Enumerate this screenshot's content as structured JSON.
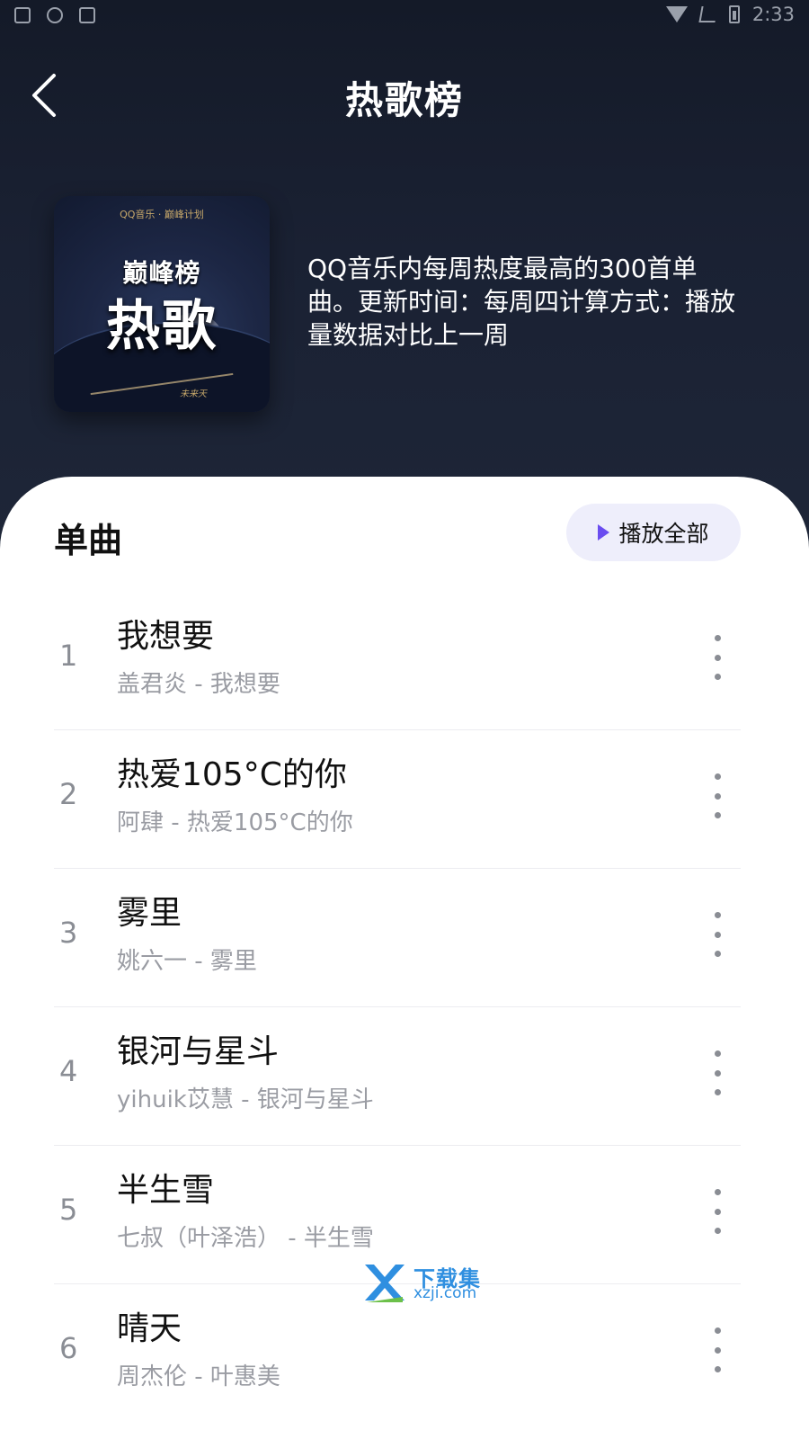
{
  "status_bar": {
    "time": "2:33"
  },
  "header": {
    "title": "热歌榜"
  },
  "cover": {
    "brand_line": "QQ音乐 · 巅峰计划",
    "subtitle": "巅峰榜",
    "main_text": "热歌",
    "signature": "未来天"
  },
  "description": "QQ音乐内每周热度最高的300首单曲。更新时间：每周四计算方式：播放量数据对比上一周",
  "list": {
    "section_title": "单曲",
    "play_all_label": "播放全部",
    "songs": [
      {
        "rank": "1",
        "title": "我想要",
        "subtitle": "盖君炎 - 我想要"
      },
      {
        "rank": "2",
        "title": "热爱105°C的你",
        "subtitle": "阿肆 - 热爱105°C的你"
      },
      {
        "rank": "3",
        "title": "雾里",
        "subtitle": "姚六一 - 雾里"
      },
      {
        "rank": "4",
        "title": "银河与星斗",
        "subtitle": "yihuik苡慧 - 银河与星斗"
      },
      {
        "rank": "5",
        "title": "半生雪",
        "subtitle": "七叔（叶泽浩） - 半生雪"
      },
      {
        "rank": "6",
        "title": "晴天",
        "subtitle": "周杰伦 - 叶惠美"
      }
    ]
  },
  "watermark": {
    "name": "下载集",
    "url": "xzji.com"
  },
  "colors": {
    "accent": "#6a4cf0",
    "hero_bg": "#1a2133",
    "play_all_bg": "#eeeefb"
  }
}
